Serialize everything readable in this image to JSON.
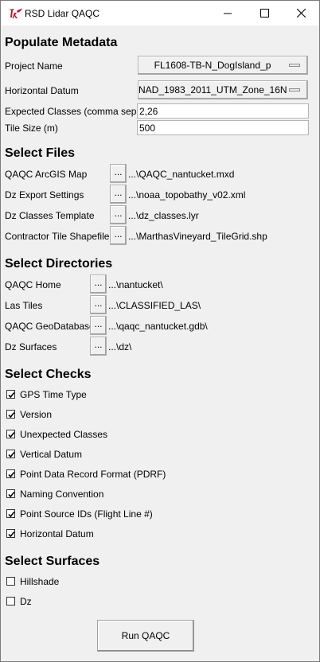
{
  "window": {
    "title": "RSD Lidar QAQC"
  },
  "metadata": {
    "heading": "Populate Metadata",
    "project_name": {
      "label": "Project Name",
      "value": "FL1608-TB-N_DogIsland_p"
    },
    "horizontal_datum": {
      "label": "Horizontal Datum",
      "value": "NAD_1983_2011_UTM_Zone_16N"
    },
    "expected_classes": {
      "label": "Expected Classes (comma sep.)",
      "value": "2,26"
    },
    "tile_size": {
      "label": "Tile Size (m)",
      "value": "500"
    }
  },
  "files": {
    "heading": "Select Files",
    "button_label": "...",
    "items": [
      {
        "label": "QAQC ArcGIS Map",
        "path": "...\\QAQC_nantucket.mxd"
      },
      {
        "label": "Dz Export Settings",
        "path": "...\\noaa_topobathy_v02.xml"
      },
      {
        "label": "Dz Classes Template",
        "path": "...\\dz_classes.lyr"
      },
      {
        "label": "Contractor Tile Shapefile",
        "path": "...\\MarthasVineyard_TileGrid.shp"
      }
    ]
  },
  "directories": {
    "heading": "Select Directories",
    "button_label": "...",
    "items": [
      {
        "label": "QAQC Home",
        "path": "...\\nantucket\\"
      },
      {
        "label": "Las Tiles",
        "path": "...\\CLASSIFIED_LAS\\"
      },
      {
        "label": "QAQC GeoDatabase",
        "path": "...\\qaqc_nantucket.gdb\\"
      },
      {
        "label": "Dz Surfaces",
        "path": "...\\dz\\"
      }
    ]
  },
  "checks": {
    "heading": "Select Checks",
    "items": [
      {
        "label": "GPS Time Type",
        "checked": true
      },
      {
        "label": "Version",
        "checked": true
      },
      {
        "label": "Unexpected Classes",
        "checked": true
      },
      {
        "label": "Vertical Datum",
        "checked": true
      },
      {
        "label": "Point Data Record Format (PDRF)",
        "checked": true
      },
      {
        "label": "Naming Convention",
        "checked": true
      },
      {
        "label": "Point Source IDs (Flight Line #)",
        "checked": true
      },
      {
        "label": "Horizontal Datum",
        "checked": true
      }
    ]
  },
  "surfaces": {
    "heading": "Select Surfaces",
    "items": [
      {
        "label": "Hillshade",
        "checked": false
      },
      {
        "label": "Dz",
        "checked": false
      }
    ]
  },
  "actions": {
    "run_label": "Run QAQC Processes"
  },
  "icons": {
    "app": "tk-feather-icon",
    "minimize": "minimize-icon",
    "maximize": "maximize-icon",
    "close": "close-icon",
    "check": "checkmark-icon",
    "menu_indicator": "option-menu-indicator-icon"
  },
  "colors": {
    "tk_logo": "#c8102e",
    "window_bg": "#f0f0f0",
    "titlebar_bg": "#ffffff"
  }
}
